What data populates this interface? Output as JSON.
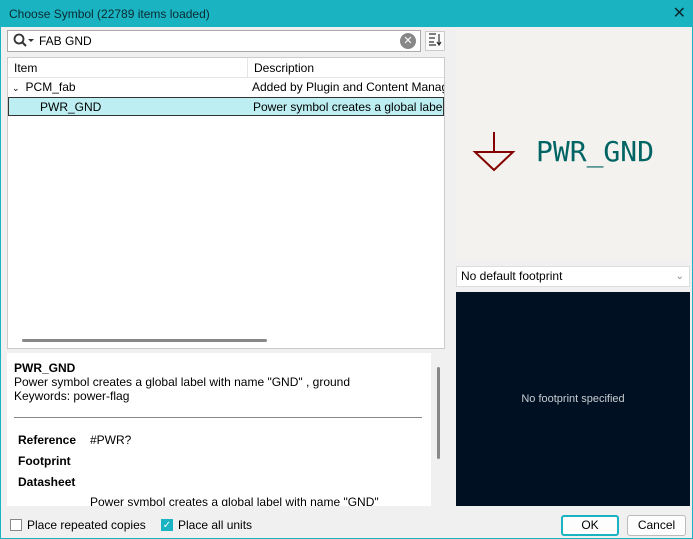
{
  "window": {
    "title": "Choose Symbol (22789 items loaded)",
    "close": "✕"
  },
  "search": {
    "value": "FAB GND"
  },
  "tree": {
    "headers": [
      "Item",
      "Description"
    ],
    "rows": [
      {
        "item": "PCM_fab",
        "desc": "Added by Plugin and Content Manager"
      },
      {
        "item": "PWR_GND",
        "desc": "Power symbol creates a global label with name \"GND\" , ground"
      }
    ]
  },
  "details": {
    "name": "PWR_GND",
    "description": "Power symbol creates a global label with name \"GND\" , ground",
    "keywords": "Keywords: power-flag",
    "props": [
      {
        "k": "Reference",
        "v": "#PWR?"
      },
      {
        "k": "Footprint",
        "v": ""
      },
      {
        "k": "Datasheet",
        "v": ""
      }
    ],
    "extra": "Power symbol creates a global label with name \"GND\""
  },
  "preview": {
    "label": "PWR_GND",
    "symbol_color": "#840000",
    "text_color": "#006464"
  },
  "footprint": {
    "selected": "No default footprint",
    "empty": "No footprint specified"
  },
  "options": {
    "repeated": "Place repeated copies",
    "repeated_checked": false,
    "all_units": "Place all units",
    "all_units_checked": true
  },
  "buttons": {
    "ok": "OK",
    "cancel": "Cancel"
  }
}
